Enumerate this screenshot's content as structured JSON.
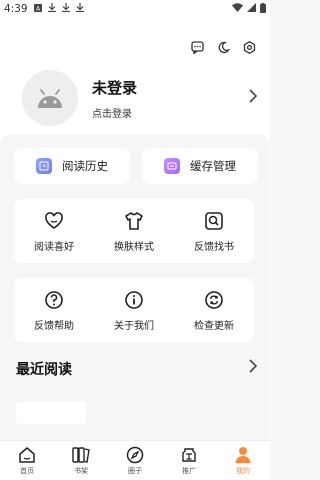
{
  "status_bar": {
    "time": "4:39"
  },
  "profile": {
    "name": "未登录",
    "subtitle": "点击登录"
  },
  "quick_actions": [
    {
      "label": "阅读历史",
      "icon": "history-icon",
      "color": "#7b8cf7"
    },
    {
      "label": "缓存管理",
      "icon": "cache-icon",
      "color": "#b57af4"
    }
  ],
  "grid_row1": [
    {
      "label": "阅读喜好",
      "icon": "heart-icon"
    },
    {
      "label": "换肤样式",
      "icon": "tshirt-icon"
    },
    {
      "label": "反馈找书",
      "icon": "search-book-icon"
    }
  ],
  "grid_row2": [
    {
      "label": "反馈帮助",
      "icon": "help-icon"
    },
    {
      "label": "关于我们",
      "icon": "info-icon"
    },
    {
      "label": "检查更新",
      "icon": "refresh-icon"
    }
  ],
  "recent": {
    "title": "最近阅读"
  },
  "bottom_nav": [
    {
      "label": "首页",
      "icon": "home-icon",
      "active": false
    },
    {
      "label": "书架",
      "icon": "bookshelf-icon",
      "active": false
    },
    {
      "label": "圈子",
      "icon": "compass-icon",
      "active": false
    },
    {
      "label": "推广",
      "icon": "promote-icon",
      "active": false
    },
    {
      "label": "我的",
      "icon": "profile-icon",
      "active": true
    }
  ],
  "colors": {
    "accent": "#ff8a3d",
    "quick_blue": "#7b8cf7",
    "quick_purple": "#b57af4"
  }
}
